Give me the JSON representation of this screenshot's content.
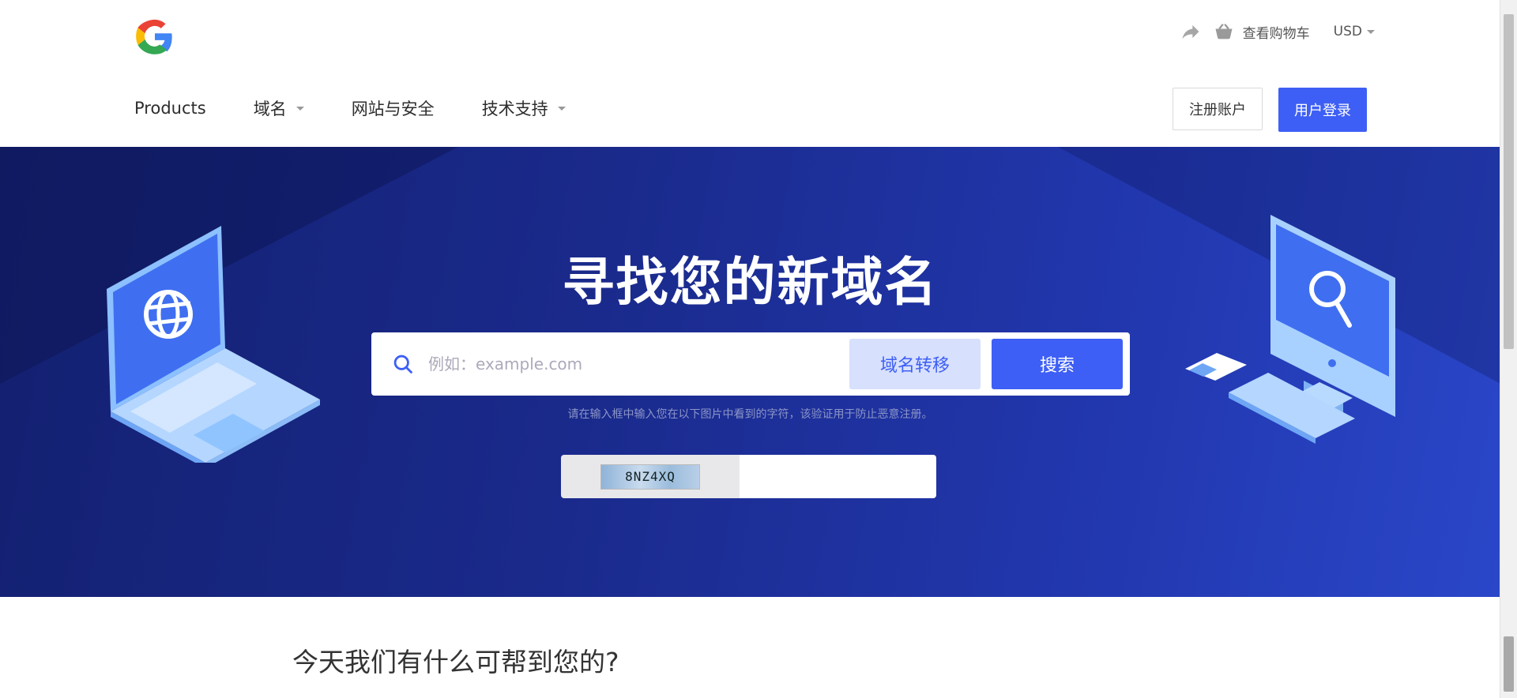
{
  "header": {
    "cart_label": "查看购物车",
    "currency": "USD"
  },
  "nav": {
    "items": [
      {
        "label": "Products",
        "has_caret": false
      },
      {
        "label": "域名",
        "has_caret": true
      },
      {
        "label": "网站与安全",
        "has_caret": false
      },
      {
        "label": "技术支持",
        "has_caret": true
      }
    ],
    "register_label": "注册账户",
    "login_label": "用户登录"
  },
  "hero": {
    "title": "寻找您的新域名",
    "search_placeholder": "例如：example.com",
    "search_value": "",
    "transfer_label": "域名转移",
    "search_label": "搜索",
    "captcha_hint": "请在输入框中输入您在以下图片中看到的字符，该验证用于防止恶意注册。",
    "captcha_text": "8NZ4XQ",
    "captcha_value": ""
  },
  "section": {
    "title": "今天我们有什么可帮到您的?"
  },
  "colors": {
    "accent": "#3e5ff5",
    "accent_light": "#d7e0fd",
    "hero_dark": "#132070",
    "hero_light": "#2a47c9"
  },
  "icons": {
    "logo": "google-g-icon",
    "share": "share-arrow-icon",
    "cart": "basket-icon",
    "search": "search-icon"
  }
}
